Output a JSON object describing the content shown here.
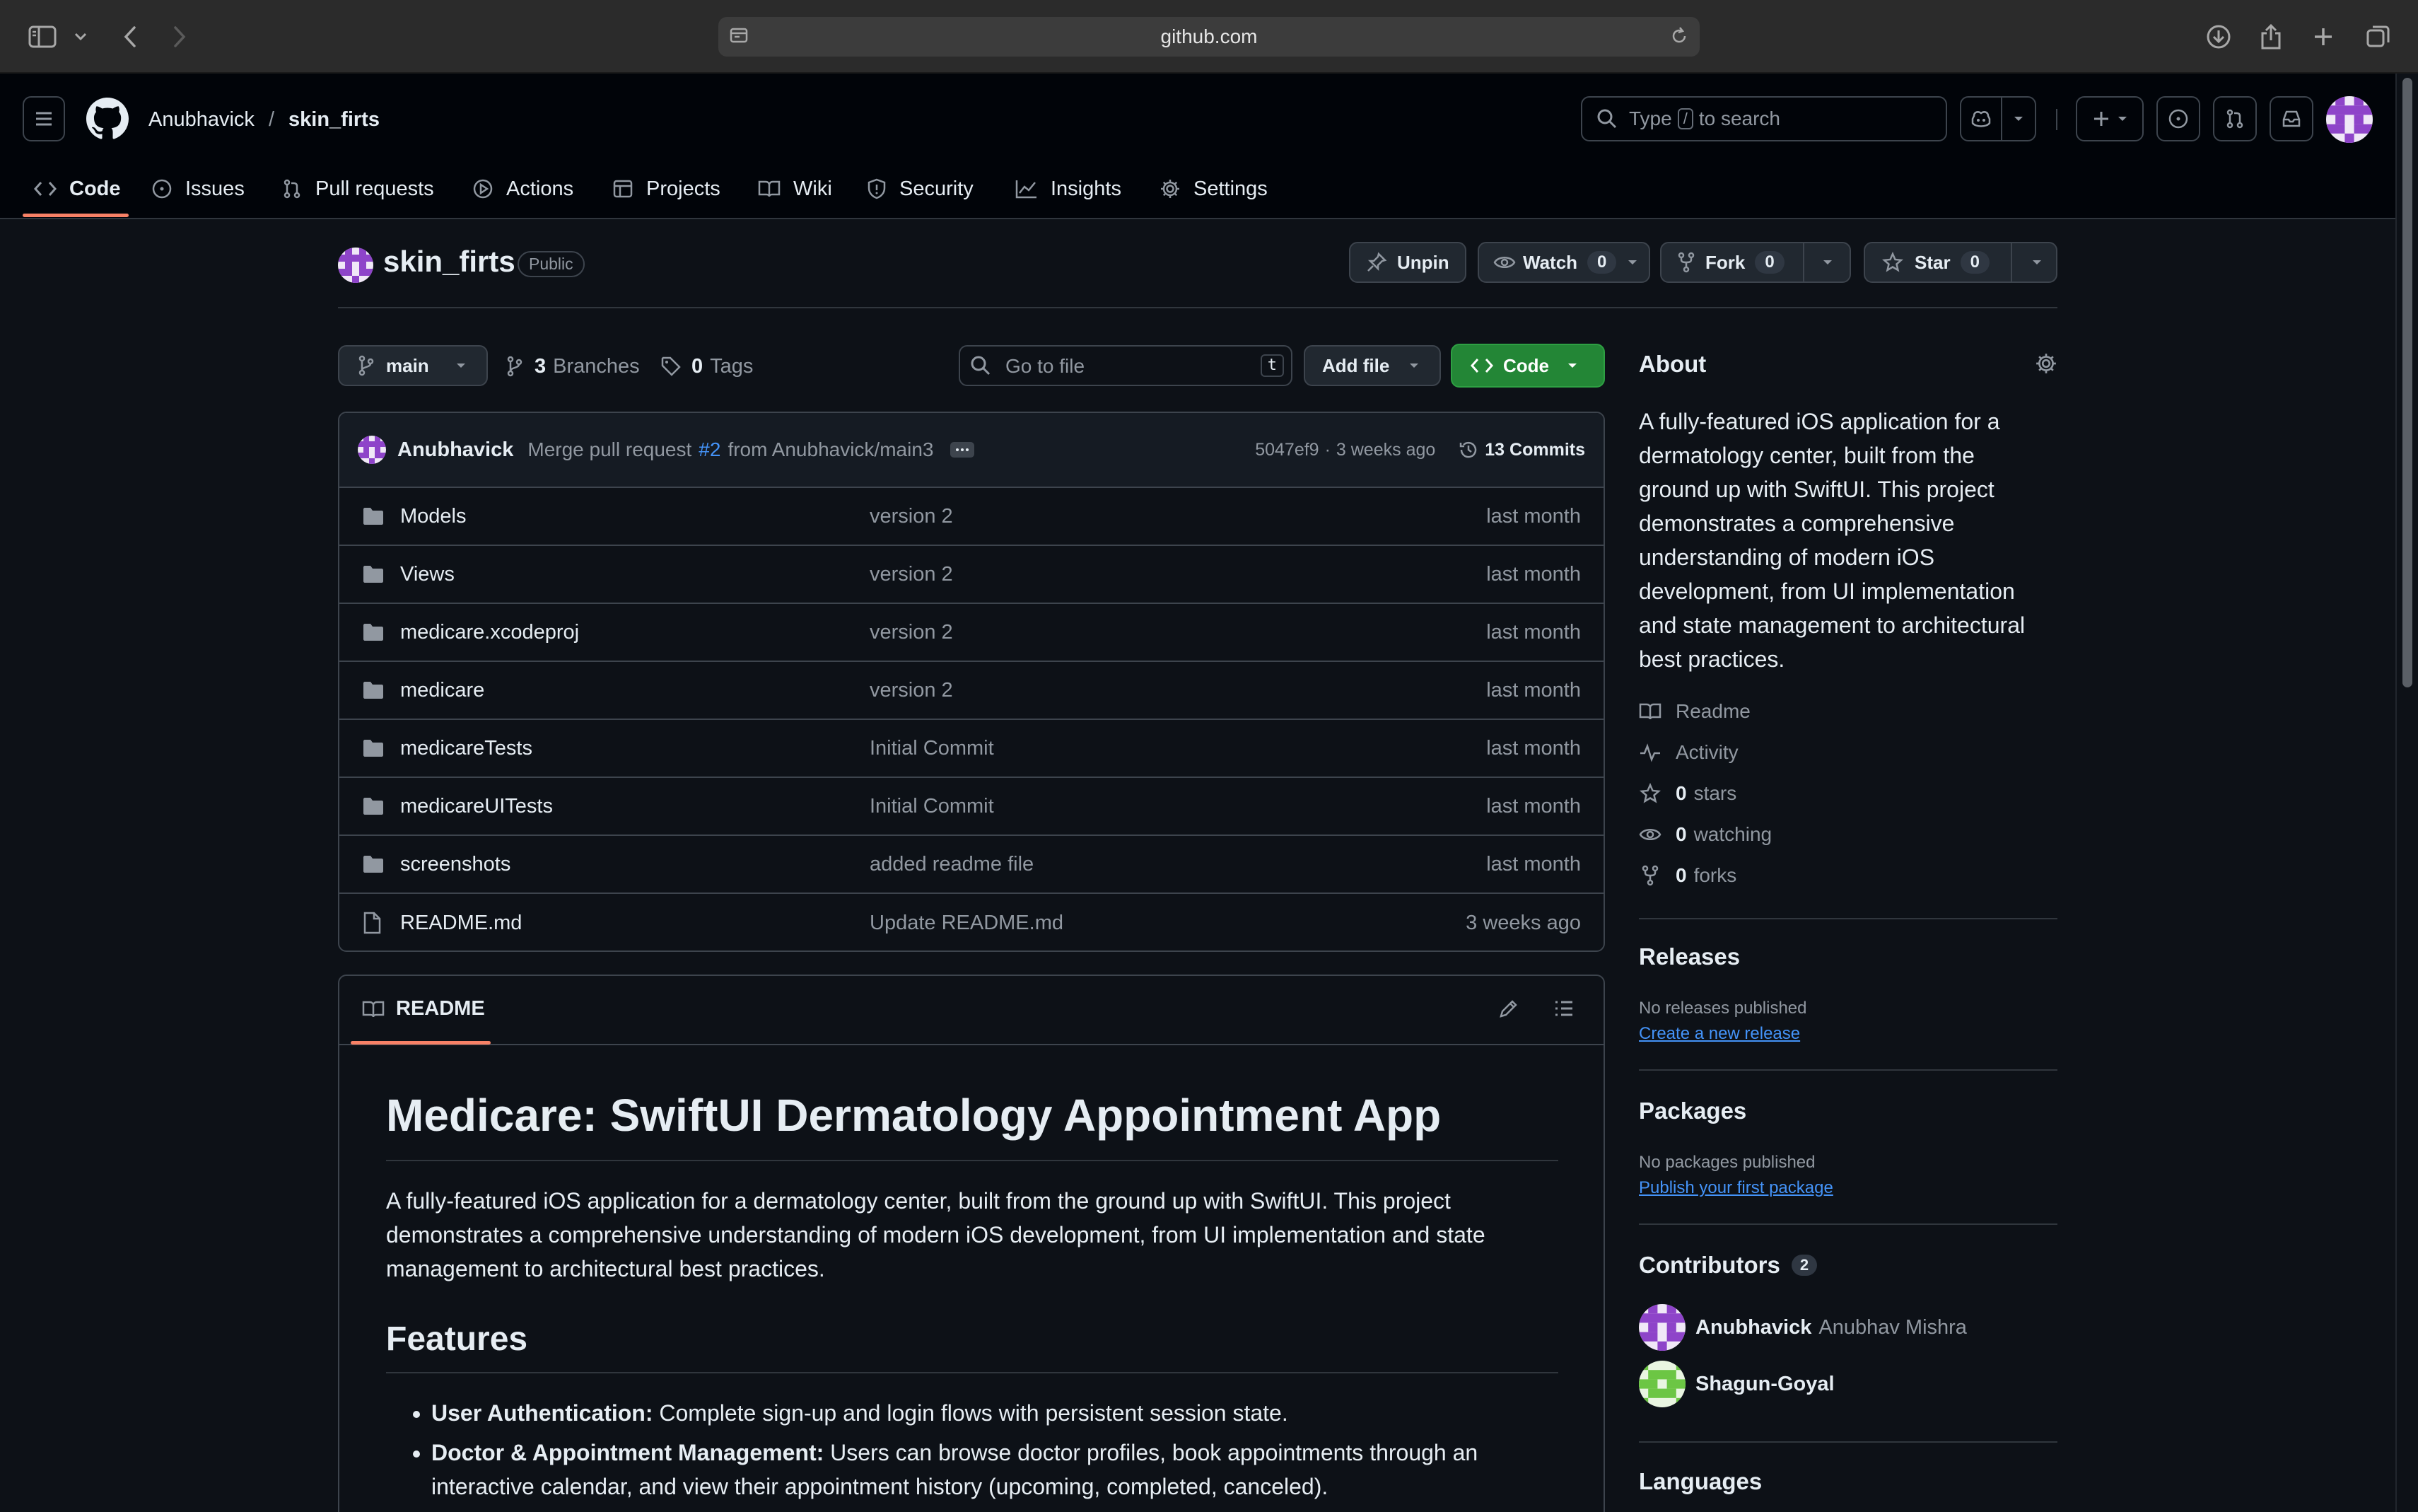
{
  "browser": {
    "url": "github.com"
  },
  "header": {
    "owner": "Anubhavick",
    "separator": "/",
    "repo": "skin_firts",
    "search_prefix": "Type",
    "search_key": "/",
    "search_suffix": "to search"
  },
  "tabs": [
    {
      "label": "Code"
    },
    {
      "label": "Issues"
    },
    {
      "label": "Pull requests"
    },
    {
      "label": "Actions"
    },
    {
      "label": "Projects"
    },
    {
      "label": "Wiki"
    },
    {
      "label": "Security"
    },
    {
      "label": "Insights"
    },
    {
      "label": "Settings"
    }
  ],
  "repo": {
    "name": "skin_firts",
    "visibility": "Public",
    "unpin_label": "Unpin",
    "watch_label": "Watch",
    "watch_count": "0",
    "fork_label": "Fork",
    "fork_count": "0",
    "star_label": "Star",
    "star_count": "0"
  },
  "toolbar": {
    "branch": "main",
    "branches_count": "3",
    "branches_label": "Branches",
    "tags_count": "0",
    "tags_label": "Tags",
    "goto_placeholder": "Go to file",
    "goto_key": "t",
    "add_file_label": "Add file",
    "code_label": "Code"
  },
  "commit": {
    "author": "Anubhavick",
    "message_prefix": "Merge pull request",
    "pr_link": "#2",
    "message_suffix": "from Anubhavick/main3",
    "hash": "5047ef9",
    "separator": "·",
    "age": "3 weeks ago",
    "commits_label": "13 Commits"
  },
  "files": [
    {
      "name": "Models",
      "type": "folder",
      "message": "version 2",
      "date": "last month"
    },
    {
      "name": "Views",
      "type": "folder",
      "message": "version 2",
      "date": "last month"
    },
    {
      "name": "medicare.xcodeproj",
      "type": "folder",
      "message": "version 2",
      "date": "last month"
    },
    {
      "name": "medicare",
      "type": "folder",
      "message": "version 2",
      "date": "last month"
    },
    {
      "name": "medicareTests",
      "type": "folder",
      "message": "Initial Commit",
      "date": "last month"
    },
    {
      "name": "medicareUITests",
      "type": "folder",
      "message": "Initial Commit",
      "date": "last month"
    },
    {
      "name": "screenshots",
      "type": "folder",
      "message": "added readme file",
      "date": "last month"
    },
    {
      "name": "README.md",
      "type": "file",
      "message": "Update README.md",
      "date": "3 weeks ago"
    }
  ],
  "readme": {
    "tab_label": "README",
    "title": "Medicare: SwiftUI Dermatology Appointment App",
    "intro": "A fully-featured iOS application for a dermatology center, built from the ground up with SwiftUI. This project demonstrates a comprehensive understanding of modern iOS development, from UI implementation and state management to architectural best practices.",
    "features_heading": "Features",
    "features": [
      {
        "bold": "User Authentication:",
        "text": " Complete sign-up and login flows with persistent session state."
      },
      {
        "bold": "Doctor & Appointment Management:",
        "text": " Users can browse doctor profiles, book appointments through an interactive calendar, and view their appointment history (upcoming, completed, canceled)."
      }
    ]
  },
  "about": {
    "heading": "About",
    "description": "A fully-featured iOS application for a dermatology center, built from the ground up with SwiftUI. This project demonstrates a comprehensive understanding of modern iOS development, from UI implementation and state management to architectural best practices.",
    "readme_label": "Readme",
    "activity_label": "Activity",
    "stars_count": "0",
    "stars_label": "stars",
    "watching_count": "0",
    "watching_label": "watching",
    "forks_count": "0",
    "forks_label": "forks"
  },
  "releases": {
    "heading": "Releases",
    "empty_text": "No releases published",
    "create_link": "Create a new release"
  },
  "packages": {
    "heading": "Packages",
    "empty_text": "No packages published",
    "publish_link": "Publish your first package"
  },
  "contributors": {
    "heading": "Contributors",
    "count": "2",
    "people": [
      {
        "login": "Anubhavick",
        "name": "Anubhav Mishra"
      },
      {
        "login": "Shagun-Goyal",
        "name": ""
      }
    ]
  },
  "languages": {
    "heading": "Languages"
  },
  "colors": {
    "accent_orange": "#f78166",
    "primary_green": "#238636",
    "link_blue": "#4493f8",
    "avatar_purple": "#8e44c9",
    "avatar_green": "#6cc644"
  }
}
